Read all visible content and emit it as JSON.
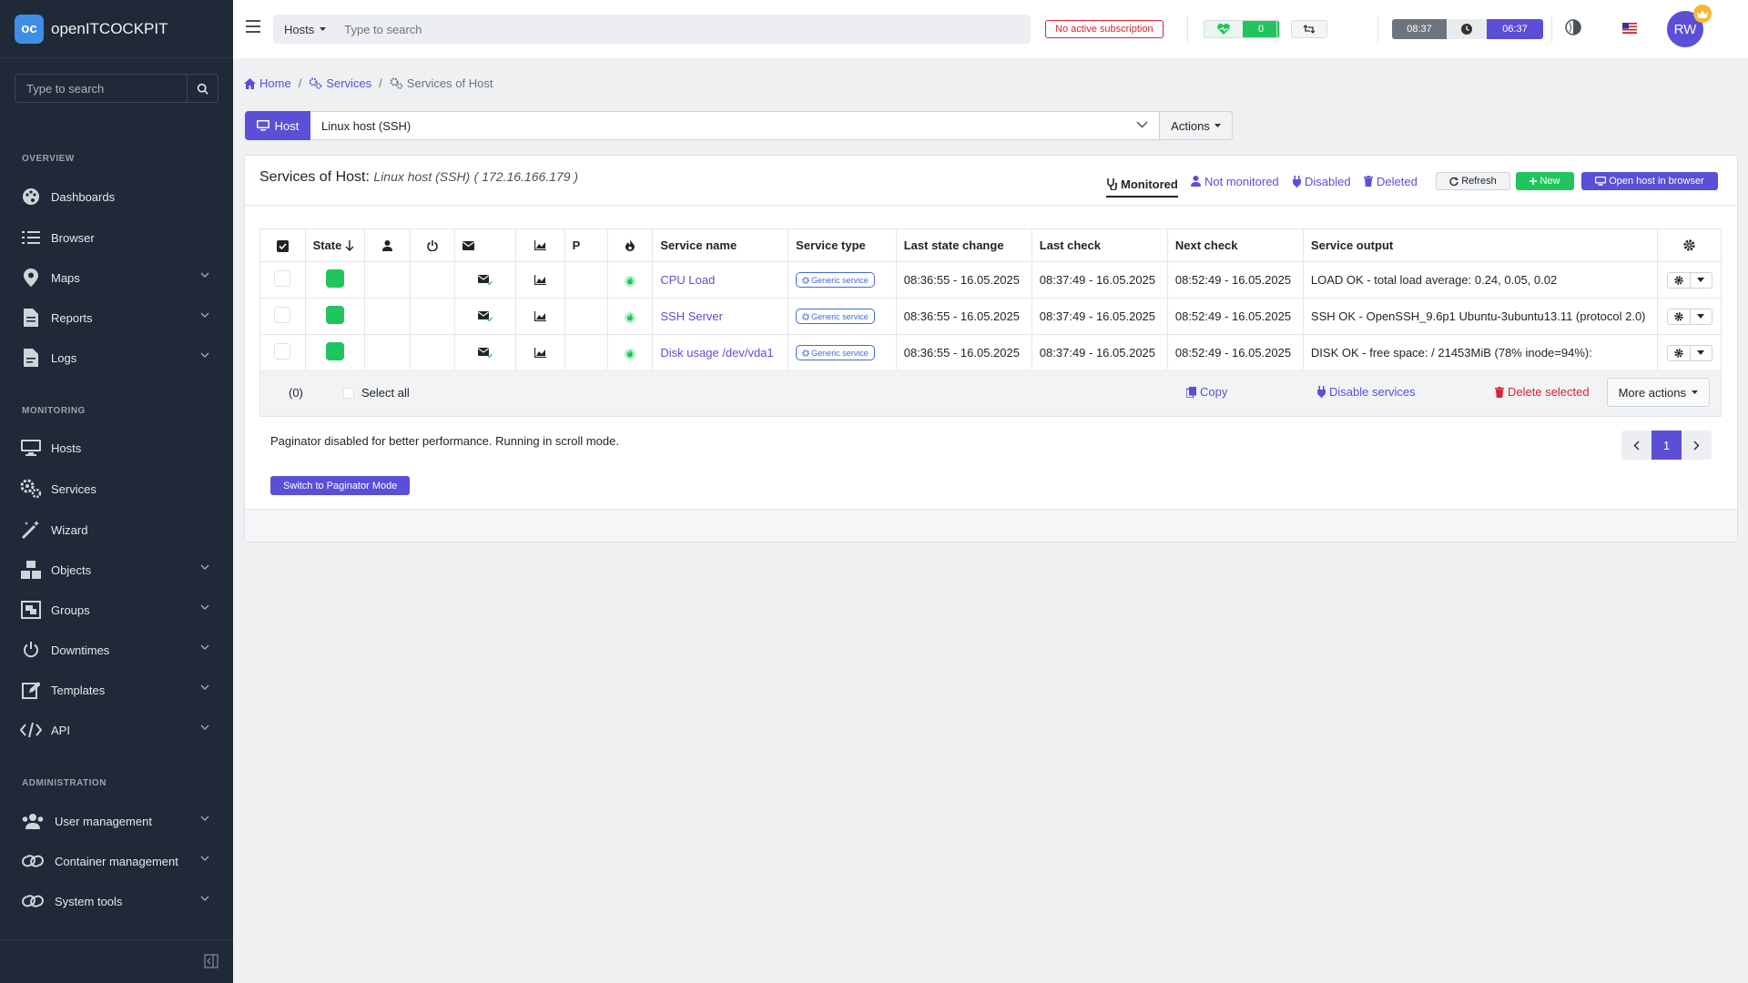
{
  "brand": {
    "name": "openITCOCKPIT",
    "logo_text": "oc"
  },
  "sidebar": {
    "search_placeholder": "Type to search",
    "sections": {
      "overview": "OVERVIEW",
      "monitoring": "MONITORING",
      "administration": "ADMINISTRATION"
    },
    "items": [
      {
        "label": "Dashboards",
        "icon": "palette-icon"
      },
      {
        "label": "Browser",
        "icon": "list-icon"
      },
      {
        "label": "Maps",
        "icon": "map-marker-icon"
      },
      {
        "label": "Reports",
        "icon": "file-icon"
      },
      {
        "label": "Logs",
        "icon": "file-text-icon"
      },
      {
        "label": "Hosts",
        "icon": "desktop-icon"
      },
      {
        "label": "Services",
        "icon": "gears-icon"
      },
      {
        "label": "Wizard",
        "icon": "wand-icon"
      },
      {
        "label": "Objects",
        "icon": "cubes-icon"
      },
      {
        "label": "Groups",
        "icon": "object-group-icon"
      },
      {
        "label": "Downtimes",
        "icon": "power-icon"
      },
      {
        "label": "Templates",
        "icon": "edit-icon"
      },
      {
        "label": "API",
        "icon": "code-icon"
      },
      {
        "label": "User management",
        "icon": "users-icon"
      },
      {
        "label": "Container management",
        "icon": "link-icon"
      },
      {
        "label": "System tools",
        "icon": "link-icon"
      }
    ]
  },
  "topbar": {
    "search_scope": "Hosts",
    "search_placeholder": "Type to search",
    "subscription": "No active subscription",
    "health_count": "0",
    "time_local": "08:37",
    "time_server": "06:37",
    "avatar": "RW"
  },
  "breadcrumb": {
    "home": "Home",
    "services": "Services",
    "current": "Services of Host"
  },
  "host_bar": {
    "host_label": "Host",
    "selected_host": "Linux host (SSH)",
    "actions": "Actions"
  },
  "card": {
    "title": "Services of Host:",
    "host_name": "Linux host (SSH)",
    "host_ip": "( 172.16.166.179 )",
    "tabs": {
      "monitored": "Monitored",
      "not_monitored": "Not monitored",
      "disabled": "Disabled",
      "deleted": "Deleted"
    },
    "buttons": {
      "refresh": "Refresh",
      "new": "New",
      "open_browser": "Open host in browser"
    }
  },
  "table": {
    "headers": {
      "state": "State",
      "p": "P",
      "service_name": "Service name",
      "service_type": "Service type",
      "last_state_change": "Last state change",
      "last_check": "Last check",
      "next_check": "Next check",
      "service_output": "Service output"
    },
    "rows": [
      {
        "name": "CPU Load",
        "type": "Generic service",
        "last_state_change": "08:36:55 - 16.05.2025",
        "last_check": "08:37:49 - 16.05.2025",
        "next_check": "08:52:49 - 16.05.2025",
        "output": "LOAD OK - total load average: 0.24, 0.05, 0.02"
      },
      {
        "name": "SSH Server",
        "type": "Generic service",
        "last_state_change": "08:36:55 - 16.05.2025",
        "last_check": "08:37:49 - 16.05.2025",
        "next_check": "08:52:49 - 16.05.2025",
        "output": "SSH OK - OpenSSH_9.6p1 Ubuntu-3ubuntu13.11 (protocol 2.0)"
      },
      {
        "name": "Disk usage /dev/vda1",
        "type": "Generic service",
        "last_state_change": "08:36:55 - 16.05.2025",
        "last_check": "08:37:49 - 16.05.2025",
        "next_check": "08:52:49 - 16.05.2025",
        "output": "DISK OK - free space: / 21453MiB (78% inode=94%):"
      }
    ],
    "state_color": "#21c55d"
  },
  "footer": {
    "selected_count": "(0)",
    "select_all": "Select all",
    "copy": "Copy",
    "disable_services": "Disable services",
    "delete_selected": "Delete selected",
    "more_actions": "More actions"
  },
  "paginator": {
    "text": "Paginator disabled for better performance. Running in scroll mode.",
    "page": "1",
    "switch_button": "Switch to Paginator Mode"
  },
  "colors": {
    "primary": "#5b4fd8",
    "success": "#21c55d",
    "danger": "#d9232e",
    "sidebar": "#1f2937"
  }
}
